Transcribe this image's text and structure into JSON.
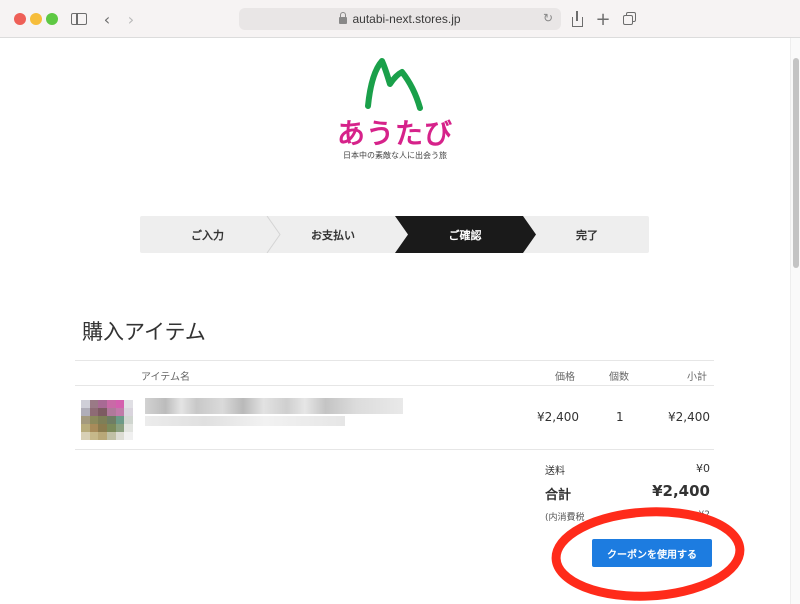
{
  "browser": {
    "url": "autabi-next.stores.jp"
  },
  "logo": {
    "name": "あうたび",
    "tagline": "日本中の素敵な人に出会う旅",
    "colors": {
      "mountain": "#1aa04a",
      "text": "#d6228a"
    }
  },
  "steps": [
    {
      "label": "ご入力",
      "active": false
    },
    {
      "label": "お支払い",
      "active": false
    },
    {
      "label": "ご確認",
      "active": true
    },
    {
      "label": "完了",
      "active": false
    }
  ],
  "section": {
    "title": "購入アイテム"
  },
  "table": {
    "headers": {
      "name": "アイテム名",
      "price": "価格",
      "qty": "個数",
      "subtotal": "小計"
    },
    "rows": [
      {
        "price": "¥2,400",
        "qty": "1",
        "subtotal": "¥2,400"
      }
    ]
  },
  "summary": {
    "shipping_label": "送料",
    "shipping_value": "¥0",
    "total_label": "合計",
    "total_value": "¥2,400",
    "tax_label": "(内消費税",
    "tax_value": "¥2"
  },
  "coupon": {
    "label": "クーポンを使用する"
  },
  "colors": {
    "accent": "#1d7ce0",
    "active_step": "#1a1a1a",
    "annotation": "#ff2b1a"
  }
}
